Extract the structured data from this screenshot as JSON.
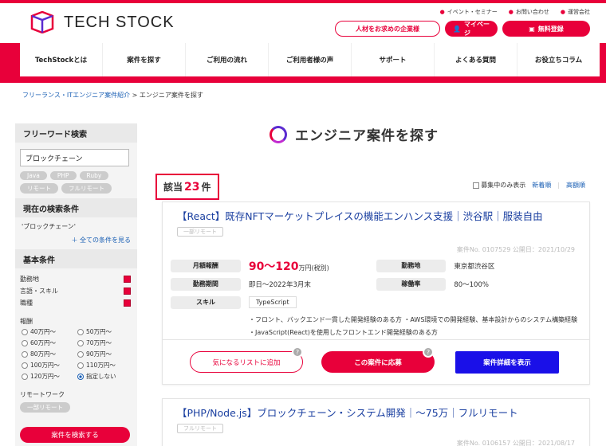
{
  "brand": {
    "name": "TECH STOCK",
    "accent": "#e8003a",
    "link": "#1a5fb4",
    "button_blue": "#1a10e8"
  },
  "toplinks": [
    "イベント・セミナー",
    "お問い合わせ",
    "運営会社"
  ],
  "header_buttons": {
    "company": "人材をお求めの企業様",
    "mypage": "マイページ",
    "register": "無料登録"
  },
  "nav": [
    "TechStockとは",
    "案件を探す",
    "ご利用の流れ",
    "ご利用者様の声",
    "サポート",
    "よくある質問",
    "お役立ちコラム"
  ],
  "breadcrumb": {
    "link": "フリーランス・ITエンジニア案件紹介",
    "sep": ">",
    "current": "エンジニア案件を探す"
  },
  "sidebar": {
    "freeword_title": "フリーワード検索",
    "freeword_value": "ブロックチェーン",
    "tags": [
      "Java",
      "PHP",
      "Ruby",
      "リモート",
      "フルリモート"
    ],
    "current_title": "現在の検索条件",
    "current_value": "'ブロックチェーン'",
    "show_all": "＋ 全ての条件を見る",
    "basic_title": "基本条件",
    "basic_items": [
      "勤務地",
      "言語・スキル",
      "職種"
    ],
    "reward_label": "報酬",
    "reward_options": [
      "40万円〜",
      "50万円〜",
      "60万円〜",
      "70万円〜",
      "80万円〜",
      "90万円〜",
      "100万円〜",
      "110万円〜",
      "120万円〜",
      "指定しない"
    ],
    "reward_selected": "指定しない",
    "remote_label": "リモートワーク",
    "remote_tag": "一部リモート",
    "search_button": "案件を検索する"
  },
  "main": {
    "title": "エンジニア案件を探す",
    "count_prefix": "該当",
    "count": "23",
    "count_suffix": "件",
    "filter_label": "募集中のみ表示",
    "sort_new": "新着順",
    "sort_high": "高額順"
  },
  "jobs": [
    {
      "title": "【React】既存NFTマーケットプレイスの機能エンハンス支援｜渋谷駅｜服装自由",
      "remote": "一部リモート",
      "meta": "案件No. 0107529 公開日：2021/10/29",
      "labels": {
        "pay": "月額報酬",
        "location": "勤務地",
        "period": "勤務期間",
        "rate": "稼働率",
        "skill": "スキル"
      },
      "pay": "90〜120",
      "pay_unit": "万円(税別)",
      "location": "東京都渋谷区",
      "period": "即日〜2022年3月末",
      "rate": "80〜100%",
      "skill": "TypeScript",
      "description": "・フロント、バックエンド一貫した開発経験のある方 ・AWS環境での開発経験、基本設計からのシステム構築経験 ・JavaScript(React)を使用したフロントエンド開発経験のある方",
      "buttons": {
        "favorite": "気になるリストに追加",
        "apply": "この案件に応募",
        "detail": "案件詳細を表示"
      },
      "help": "?"
    },
    {
      "title": "【PHP/Node.js】ブロックチェーン・システム開発｜〜75万｜フルリモート",
      "remote": "フルリモート",
      "meta": "案件No. 0106157 公開日：2021/08/17"
    }
  ]
}
